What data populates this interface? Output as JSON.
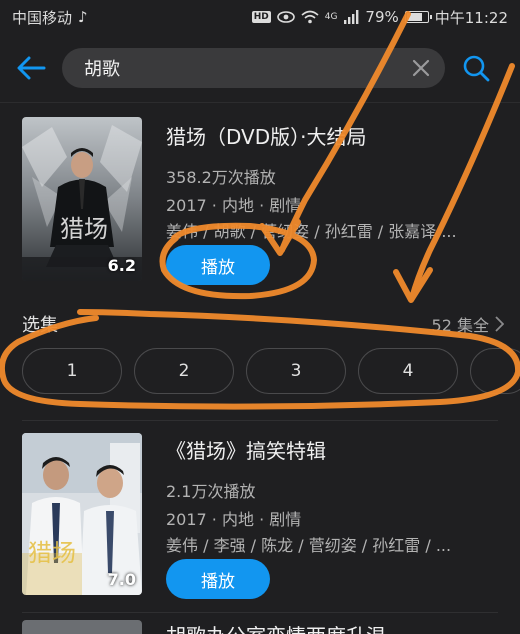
{
  "status_bar": {
    "carrier": "中国移动",
    "carrier_extra": "♪",
    "network": "4G",
    "battery": "79%",
    "battery_level": 0.79,
    "time": "中午11:22"
  },
  "search": {
    "query": "胡歌"
  },
  "results": [
    {
      "title": "猎场（DVD版）·大结局",
      "plays": "358.2万次播放",
      "meta": "2017 · 内地 · 剧情",
      "cast": "姜伟 / 胡歌 / 菅纫姿 / 孙红雷 / 张嘉译 ...",
      "rating": "6.2",
      "poster_text": "猎场",
      "play_label": "播放"
    },
    {
      "title": "《猎场》搞笑特辑",
      "plays": "2.1万次播放",
      "meta": "2017 · 内地 · 剧情",
      "cast": "姜伟 / 李强 / 陈龙 / 菅纫姿 / 孙红雷 / ...",
      "rating": "7.0",
      "poster_text": "猎场",
      "play_label": "播放"
    },
    {
      "title": "胡歌办公室恋情两度升温"
    }
  ],
  "episodes": {
    "label": "选集",
    "total": "52 集全",
    "items": [
      "1",
      "2",
      "3",
      "4",
      ""
    ]
  },
  "colors": {
    "background": "#1f1f21",
    "accent": "#1296f0",
    "annotation": "#f08a2c"
  }
}
